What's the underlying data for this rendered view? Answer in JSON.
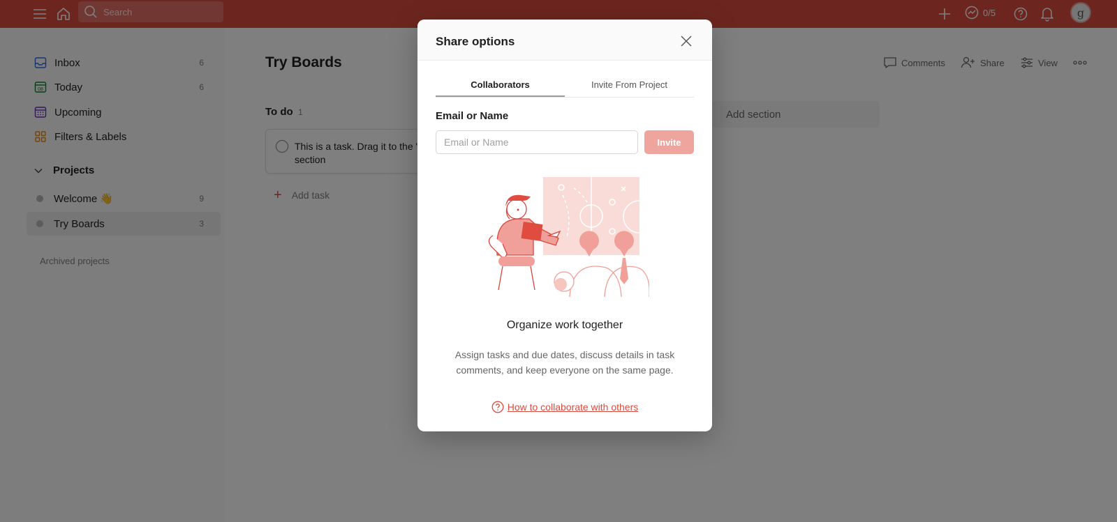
{
  "topbar": {
    "search_placeholder": "Search",
    "karma": "0/5",
    "avatar_initial": "g"
  },
  "sidebar": {
    "items": [
      {
        "label": "Inbox",
        "count": "6",
        "icon": "inbox-icon"
      },
      {
        "label": "Today",
        "count": "6",
        "icon": "calendar-today-icon"
      },
      {
        "label": "Upcoming",
        "count": "",
        "icon": "calendar-upcoming-icon"
      },
      {
        "label": "Filters & Labels",
        "count": "",
        "icon": "filters-grid-icon"
      }
    ],
    "projects_label": "Projects",
    "projects": [
      {
        "label": "Welcome 👋",
        "count": "9"
      },
      {
        "label": "Try Boards",
        "count": "3"
      }
    ],
    "archived_label": "Archived projects"
  },
  "main": {
    "title": "Try Boards",
    "toolbar": {
      "comments": "Comments",
      "share": "Share",
      "view": "View"
    },
    "section": {
      "title": "To do",
      "count": "1",
      "task": "This is a task. Drag it to the \"Doing\" section",
      "add_task": "Add task"
    },
    "add_section": "Add section"
  },
  "modal": {
    "title": "Share options",
    "tabs": [
      "Collaborators",
      "Invite From Project"
    ],
    "field_label": "Email or Name",
    "input_placeholder": "Email or Name",
    "input_value": "",
    "invite_label": "Invite",
    "empty_title": "Organize work together",
    "empty_desc": "Assign tasks and due dates, discuss details in task comments, and keep everyone on the same page.",
    "help_link": "How to collaborate with others"
  },
  "colors": {
    "brand": "#db4c3f",
    "invite_disabled": "#eea59e"
  }
}
